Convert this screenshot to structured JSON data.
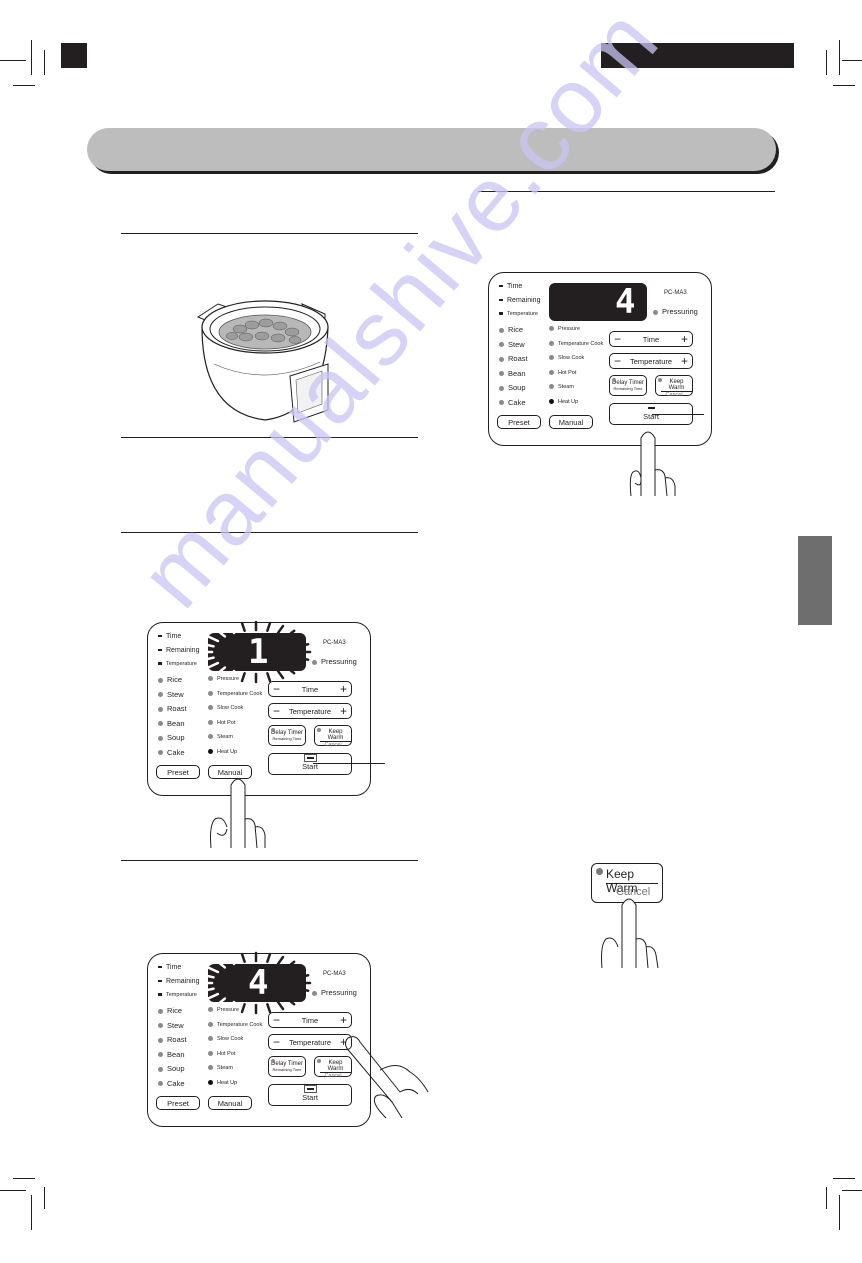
{
  "page": {
    "header": {
      "left_block": "",
      "right_block": "",
      "title_bar": ""
    },
    "side_tab": "",
    "watermark": "manualshive.com"
  },
  "panels": [
    {
      "id": "panel-step-start",
      "display_value": "4",
      "display_state": "steady",
      "model": "PC-MA3",
      "pressuring": "Pressuring",
      "indicators": [
        "Time",
        "Remaining",
        "Temperature"
      ],
      "menu_left": [
        "Rice",
        "Stew",
        "Roast",
        "Bean",
        "Soup",
        "Cake"
      ],
      "menu_right": [
        "Pressure",
        "Temperature Cook",
        "Slow Cook",
        "Hot Pot",
        "Steam",
        "Heat Up"
      ],
      "active_menu": "Heat Up",
      "time_label": "Time",
      "temperature_label": "Temperature",
      "minus": "−",
      "plus": "+",
      "delay_timer": "Delay Timer",
      "remaining_time": "Remaining Time",
      "keep_warm": "Keep Warm",
      "cancel": "Cancel",
      "start": "Start",
      "preset": "Preset",
      "manual": "Manual",
      "pressed_button": "Start"
    },
    {
      "id": "panel-step-manual",
      "display_value": "1",
      "display_state": "flashing",
      "model": "PC-MA3",
      "pressuring": "Pressuring",
      "indicators": [
        "Time",
        "Remaining",
        "Temperature"
      ],
      "menu_left": [
        "Rice",
        "Stew",
        "Roast",
        "Bean",
        "Soup",
        "Cake"
      ],
      "menu_right": [
        "Pressure",
        "Temperature Cook",
        "Slow Cook",
        "Hot Pot",
        "Steam",
        "Heat Up"
      ],
      "active_menu": "Heat Up",
      "time_label": "Time",
      "temperature_label": "Temperature",
      "minus": "−",
      "plus": "+",
      "delay_timer": "Delay Timer",
      "remaining_time": "Remaining Time",
      "keep_warm": "Keep Warm",
      "cancel": "Cancel",
      "start": "Start",
      "preset": "Preset",
      "manual": "Manual",
      "pressed_button": "Manual"
    },
    {
      "id": "panel-step-temperature",
      "display_value": "4",
      "display_state": "flashing",
      "model": "PC-MA3",
      "pressuring": "Pressuring",
      "indicators": [
        "Time",
        "Remaining",
        "Temperature"
      ],
      "menu_left": [
        "Rice",
        "Stew",
        "Roast",
        "Bean",
        "Soup",
        "Cake"
      ],
      "menu_right": [
        "Pressure",
        "Temperature Cook",
        "Slow Cook",
        "Hot Pot",
        "Steam",
        "Heat Up"
      ],
      "active_menu": "Heat Up",
      "time_label": "Time",
      "temperature_label": "Temperature",
      "minus": "−",
      "plus": "+",
      "delay_timer": "Delay Timer",
      "remaining_time": "Remaining Time",
      "keep_warm": "Keep Warm",
      "cancel": "Cancel",
      "start": "Start",
      "preset": "Preset",
      "manual": "Manual",
      "pressed_button": "Temperature +"
    }
  ],
  "keep_warm_closeup": {
    "top_label": "Keep Warm",
    "bottom_label": "Cancel",
    "pressed": "Cancel"
  },
  "icons": {
    "pot": "pressure-cooker-with-beans",
    "hand": "pointing-hand",
    "led": "indicator-led"
  }
}
